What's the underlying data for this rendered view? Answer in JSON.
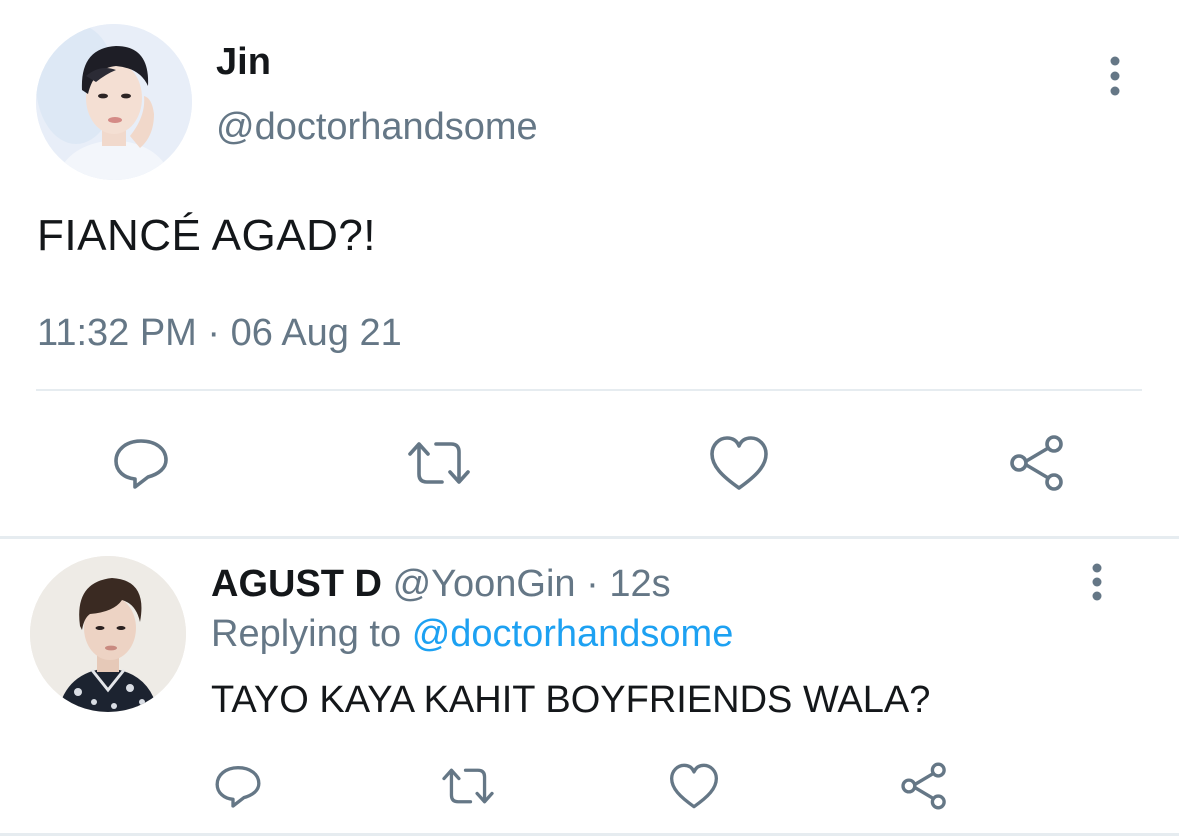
{
  "main_tweet": {
    "display_name": "Jin",
    "handle": "@doctorhandsome",
    "text": "FIANCÉ AGAD?!",
    "timestamp": "11:32 PM · 06 Aug 21",
    "actions": [
      "reply-icon",
      "retweet-icon",
      "like-icon",
      "share-icon"
    ],
    "menu_icon": "more-vertical-icon"
  },
  "reply_tweet": {
    "display_name": "AGUST D",
    "handle": "@YoonGin",
    "separator": "·",
    "time_ago": "12s",
    "replying_prefix": "Replying to",
    "replying_to": "@doctorhandsome",
    "text": "TAYO KAYA KAHIT BOYFRIENDS WALA?",
    "actions": [
      "reply-icon",
      "retweet-icon",
      "like-icon",
      "share-icon"
    ],
    "menu_icon": "more-vertical-icon"
  },
  "colors": {
    "primary_text": "#14171a",
    "secondary_text": "#657786",
    "link": "#1da1f2",
    "divider": "#e6ecf0",
    "icon": "#657786"
  }
}
